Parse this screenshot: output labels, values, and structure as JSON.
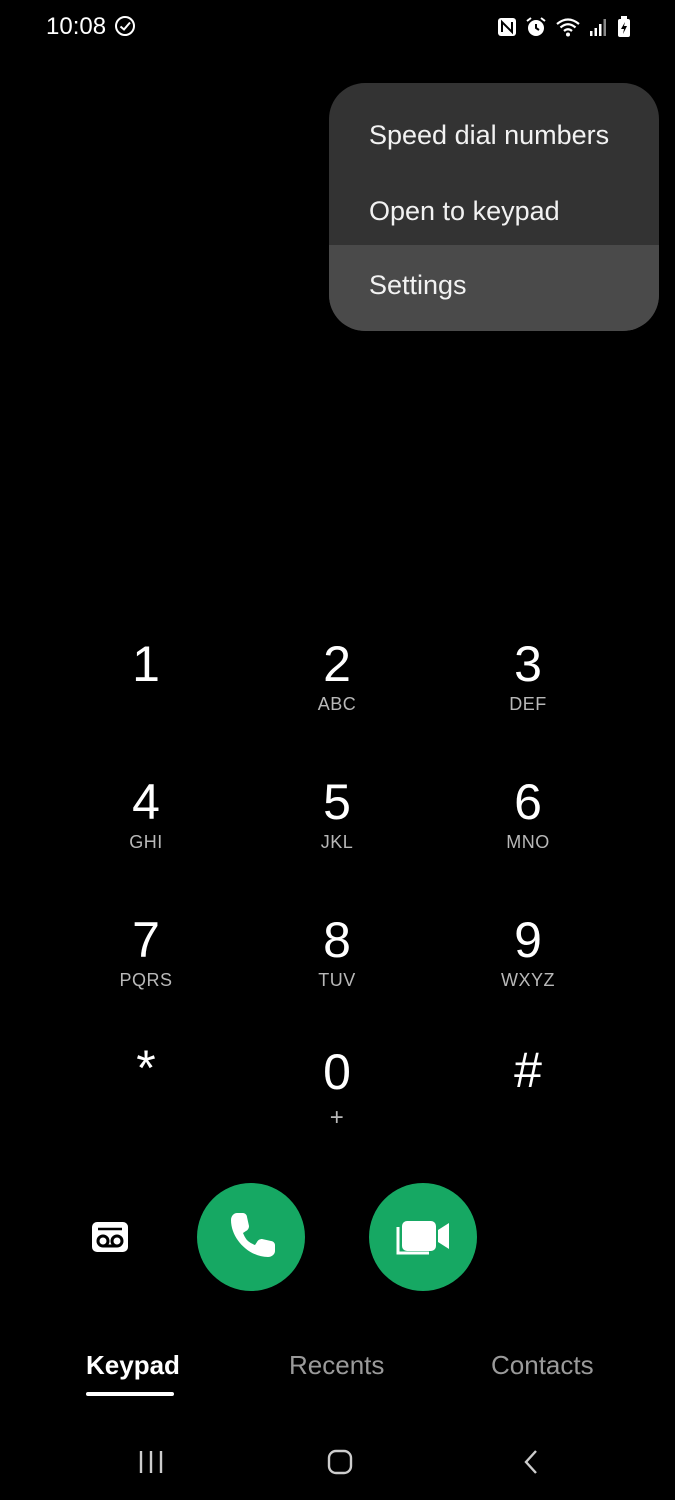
{
  "status_bar": {
    "time": "10:08",
    "icons": [
      "check-circle-icon",
      "nfc-icon",
      "alarm-icon",
      "wifi-icon",
      "signal-icon",
      "battery-charging-icon"
    ]
  },
  "menu": {
    "items": [
      {
        "label": "Speed dial numbers",
        "selected": false
      },
      {
        "label": "Open to keypad",
        "selected": false
      },
      {
        "label": "Settings",
        "selected": true
      }
    ]
  },
  "keypad": {
    "keys": [
      {
        "digit": "1",
        "letters": ""
      },
      {
        "digit": "2",
        "letters": "ABC"
      },
      {
        "digit": "3",
        "letters": "DEF"
      },
      {
        "digit": "4",
        "letters": "GHI"
      },
      {
        "digit": "5",
        "letters": "JKL"
      },
      {
        "digit": "6",
        "letters": "MNO"
      },
      {
        "digit": "7",
        "letters": "PQRS"
      },
      {
        "digit": "8",
        "letters": "TUV"
      },
      {
        "digit": "9",
        "letters": "WXYZ"
      },
      {
        "digit": "*",
        "letters": ""
      },
      {
        "digit": "0",
        "letters": "+"
      },
      {
        "digit": "#",
        "letters": ""
      }
    ]
  },
  "actions": {
    "voicemail_icon": "voicemail-icon",
    "call_icon": "phone-icon",
    "video_icon": "video-camera-icon",
    "accent_color": "#16a863"
  },
  "tabs": {
    "keypad": "Keypad",
    "recents": "Recents",
    "contacts": "Contacts"
  },
  "navbar": {
    "icons": [
      "recent-apps-icon",
      "home-icon",
      "back-icon"
    ]
  }
}
